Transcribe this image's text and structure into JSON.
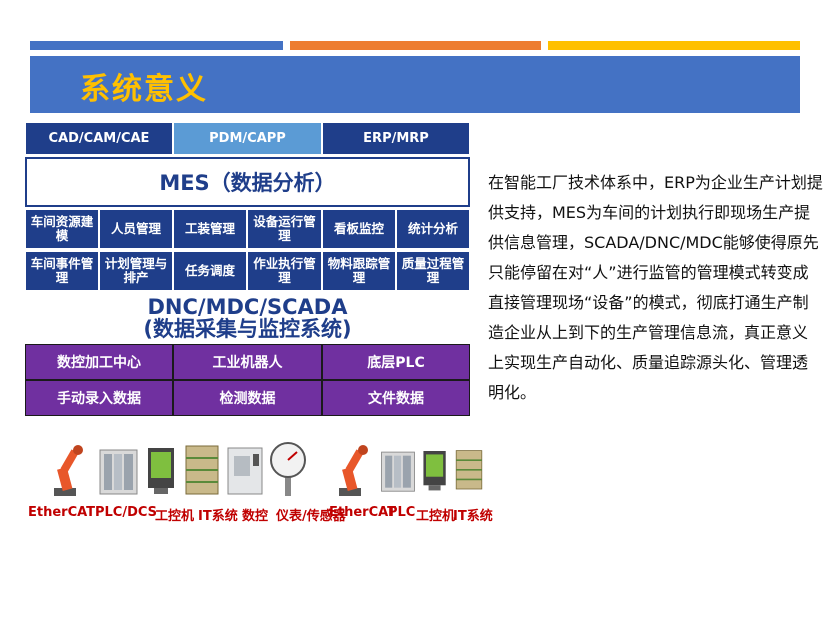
{
  "slide": {
    "title": "系统意义",
    "colors": {
      "accent_blue": "#4472c4",
      "orange": "#ed7d31",
      "yellow": "#ffc000",
      "navy": "#1f3e8a",
      "purple": "#7030a0"
    }
  },
  "diagram": {
    "top_row": [
      "CAD/CAM/CAE",
      "PDM/CAPP",
      "ERP/MRP"
    ],
    "mes_title": "MES（数据分析）",
    "modules_row1": [
      "车间资源建模",
      "人员管理",
      "工装管理",
      "设备运行管理",
      "看板监控",
      "统计分析"
    ],
    "modules_row2": [
      "车间事件管理",
      "计划管理与排产",
      "任务调度",
      "作业执行管理",
      "物料跟踪管理",
      "质量过程管理"
    ],
    "dnc_line1": "DNC/MDC/SCADA",
    "dnc_line2": "(数据采集与监控系统)",
    "bottom_row1": [
      "数控加工中心",
      "工业机器人",
      "底层PLC"
    ],
    "bottom_row2": [
      "手动录入数据",
      "检测数据",
      "文件数据"
    ]
  },
  "description": "在智能工厂技术体系中，ERP为企业生产计划提供支持，MES为车间的计划执行即现场生产提供信息管理，SCADA/DNC/MDC能够使得原先只能停留在对“人”进行监管的管理模式转变成直接管理现场“设备”的模式，彻底打通生产制造企业从上到下的生产管理信息流，真正意义上实现生产自动化、质量追踪源头化、管理透明化。",
  "devices": {
    "labels": [
      "EtherCAT",
      "PLC/DCS",
      "工控机",
      "IT系统",
      "数控",
      "仪表/传感器",
      "EtherCAT",
      "PLC",
      "工控机",
      "IT系统"
    ],
    "icons": [
      "robot-arm-icon",
      "plc-icon",
      "industrial-pc-icon",
      "it-system-icon",
      "cnc-machine-icon",
      "gauge-icon",
      "robot-arm-icon",
      "plc-icon",
      "industrial-pc-icon",
      "it-system-icon"
    ]
  }
}
